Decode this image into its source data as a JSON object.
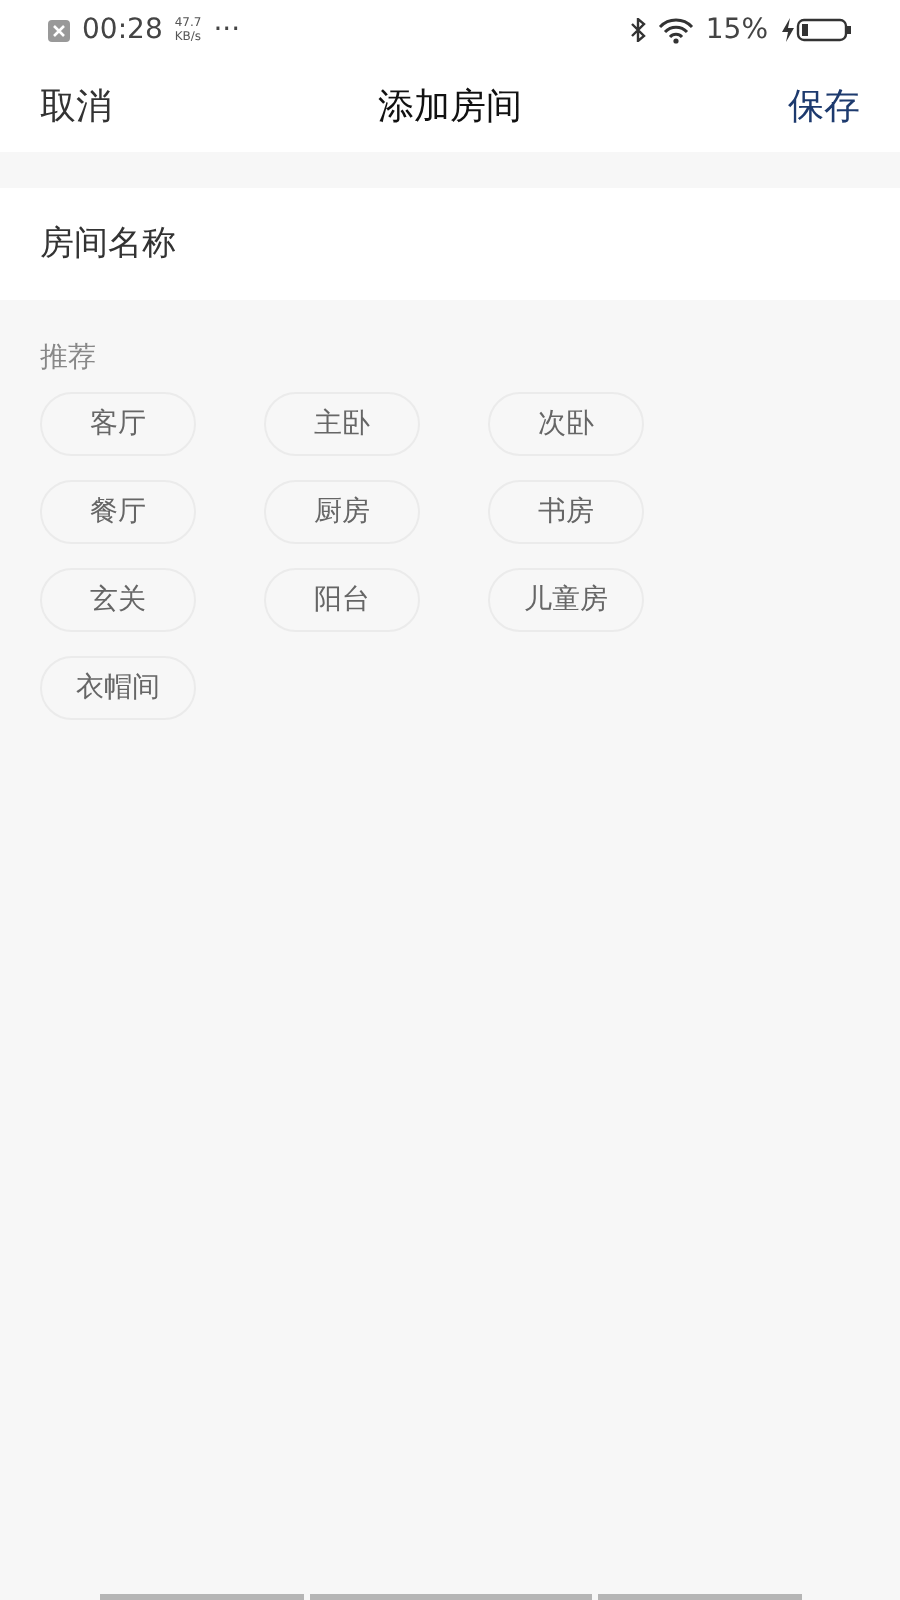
{
  "status_bar": {
    "time": "00:28",
    "speed_value": "47.7",
    "speed_unit": "KB/s",
    "more": "···",
    "battery": "15%"
  },
  "nav": {
    "cancel": "取消",
    "title": "添加房间",
    "save": "保存"
  },
  "name_field": {
    "placeholder": "房间名称"
  },
  "recommend": {
    "label": "推荐",
    "chips": [
      "客厅",
      "主卧",
      "次卧",
      "餐厅",
      "厨房",
      "书房",
      "玄关",
      "阳台",
      "儿童房",
      "衣帽间"
    ]
  }
}
